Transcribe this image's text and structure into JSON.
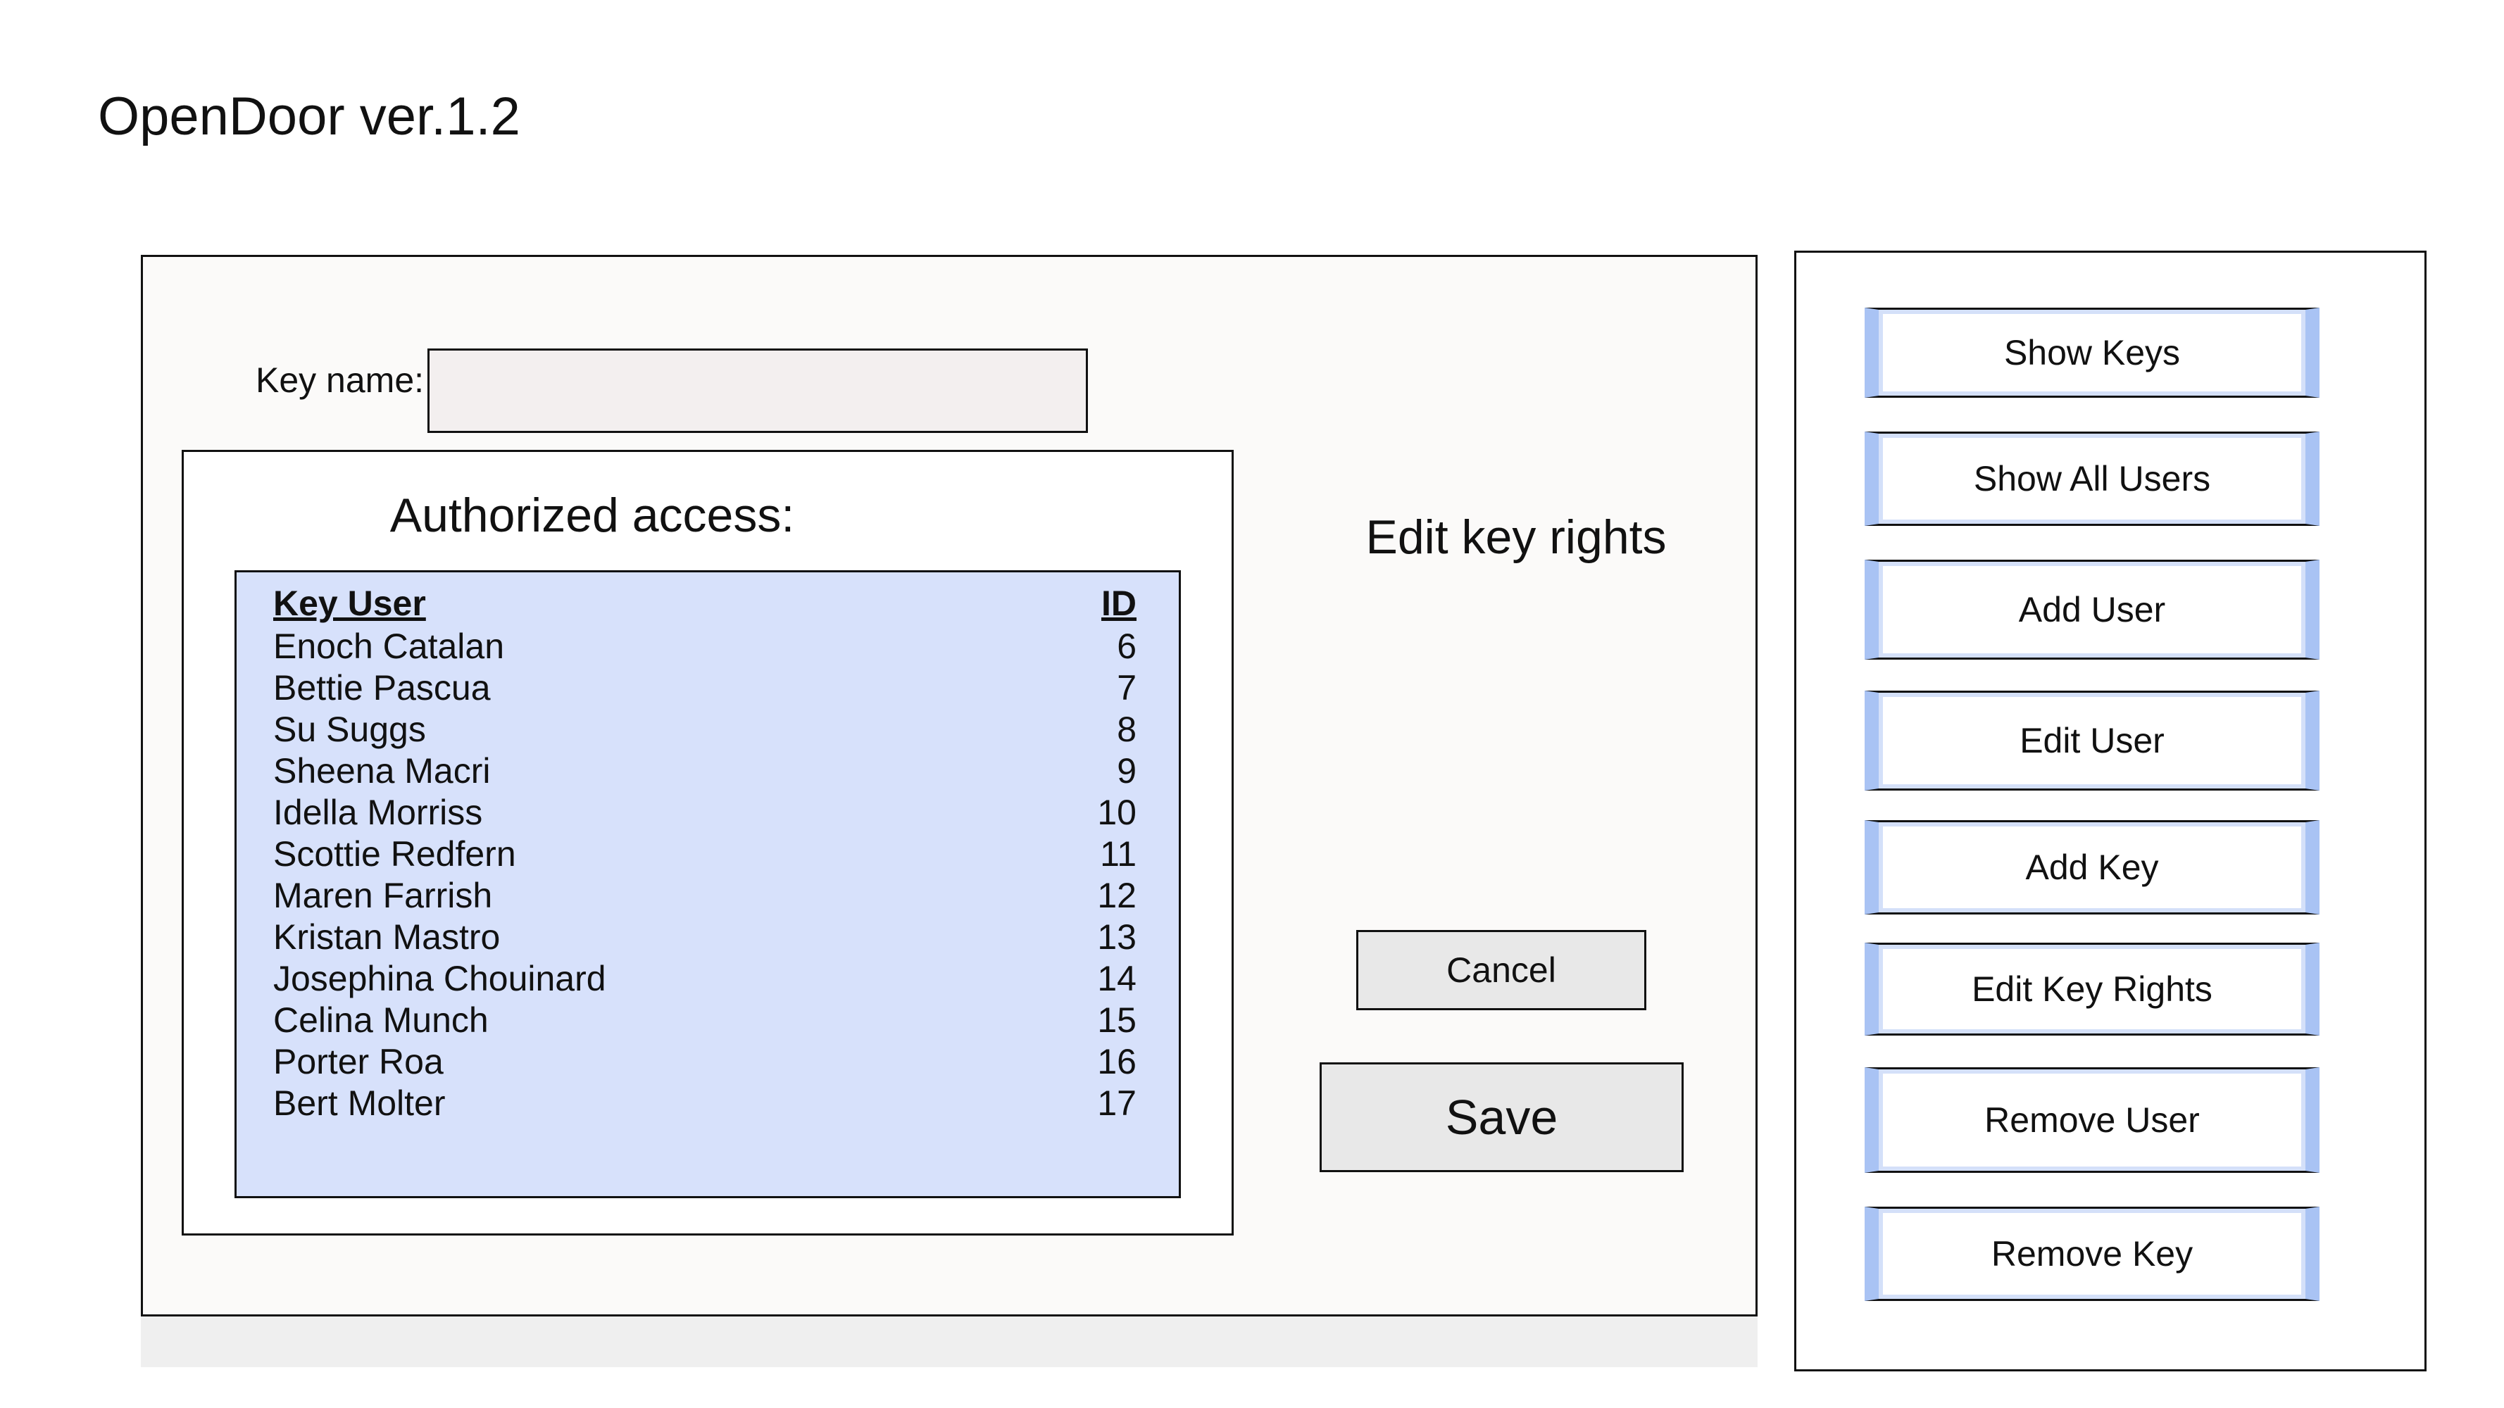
{
  "app": {
    "title": "OpenDoor ver.1.2"
  },
  "form": {
    "key_name_label": "Key name:",
    "key_name_value": "",
    "authorized_title": "Authorized access:",
    "edit_title": "Edit key rights",
    "cancel_label": "Cancel",
    "save_label": "Save"
  },
  "table": {
    "headers": {
      "user": "Key User ",
      "id": "ID"
    },
    "rows": [
      {
        "name": "Enoch Catalan",
        "id": "6"
      },
      {
        "name": "Bettie Pascua",
        "id": "7"
      },
      {
        "name": "Su Suggs",
        "id": "8"
      },
      {
        "name": "Sheena Macri",
        "id": "9"
      },
      {
        "name": "Idella Morriss",
        "id": "10"
      },
      {
        "name": "Scottie Redfern",
        "id": "11"
      },
      {
        "name": "Maren Farrish",
        "id": "12"
      },
      {
        "name": "Kristan Mastro",
        "id": "13"
      },
      {
        "name": "Josephina Chouinard",
        "id": "14"
      },
      {
        "name": "Celina Munch",
        "id": "15"
      },
      {
        "name": "Porter Roa",
        "id": "16"
      },
      {
        "name": "Bert Molter",
        "id": "17"
      }
    ]
  },
  "sidebar": {
    "buttons": [
      {
        "label": "Show Keys"
      },
      {
        "label": "Show All Users"
      },
      {
        "label": "Add User"
      },
      {
        "label": "Edit User"
      },
      {
        "label": "Add Key"
      },
      {
        "label": "Edit Key Rights"
      },
      {
        "label": "Remove User"
      },
      {
        "label": "Remove Key"
      }
    ]
  },
  "colors": {
    "list_background": "#d7e1fb",
    "button_accent": "#a9c3f4",
    "input_background": "#f3efef",
    "panel_background": "#fbfaf9"
  }
}
